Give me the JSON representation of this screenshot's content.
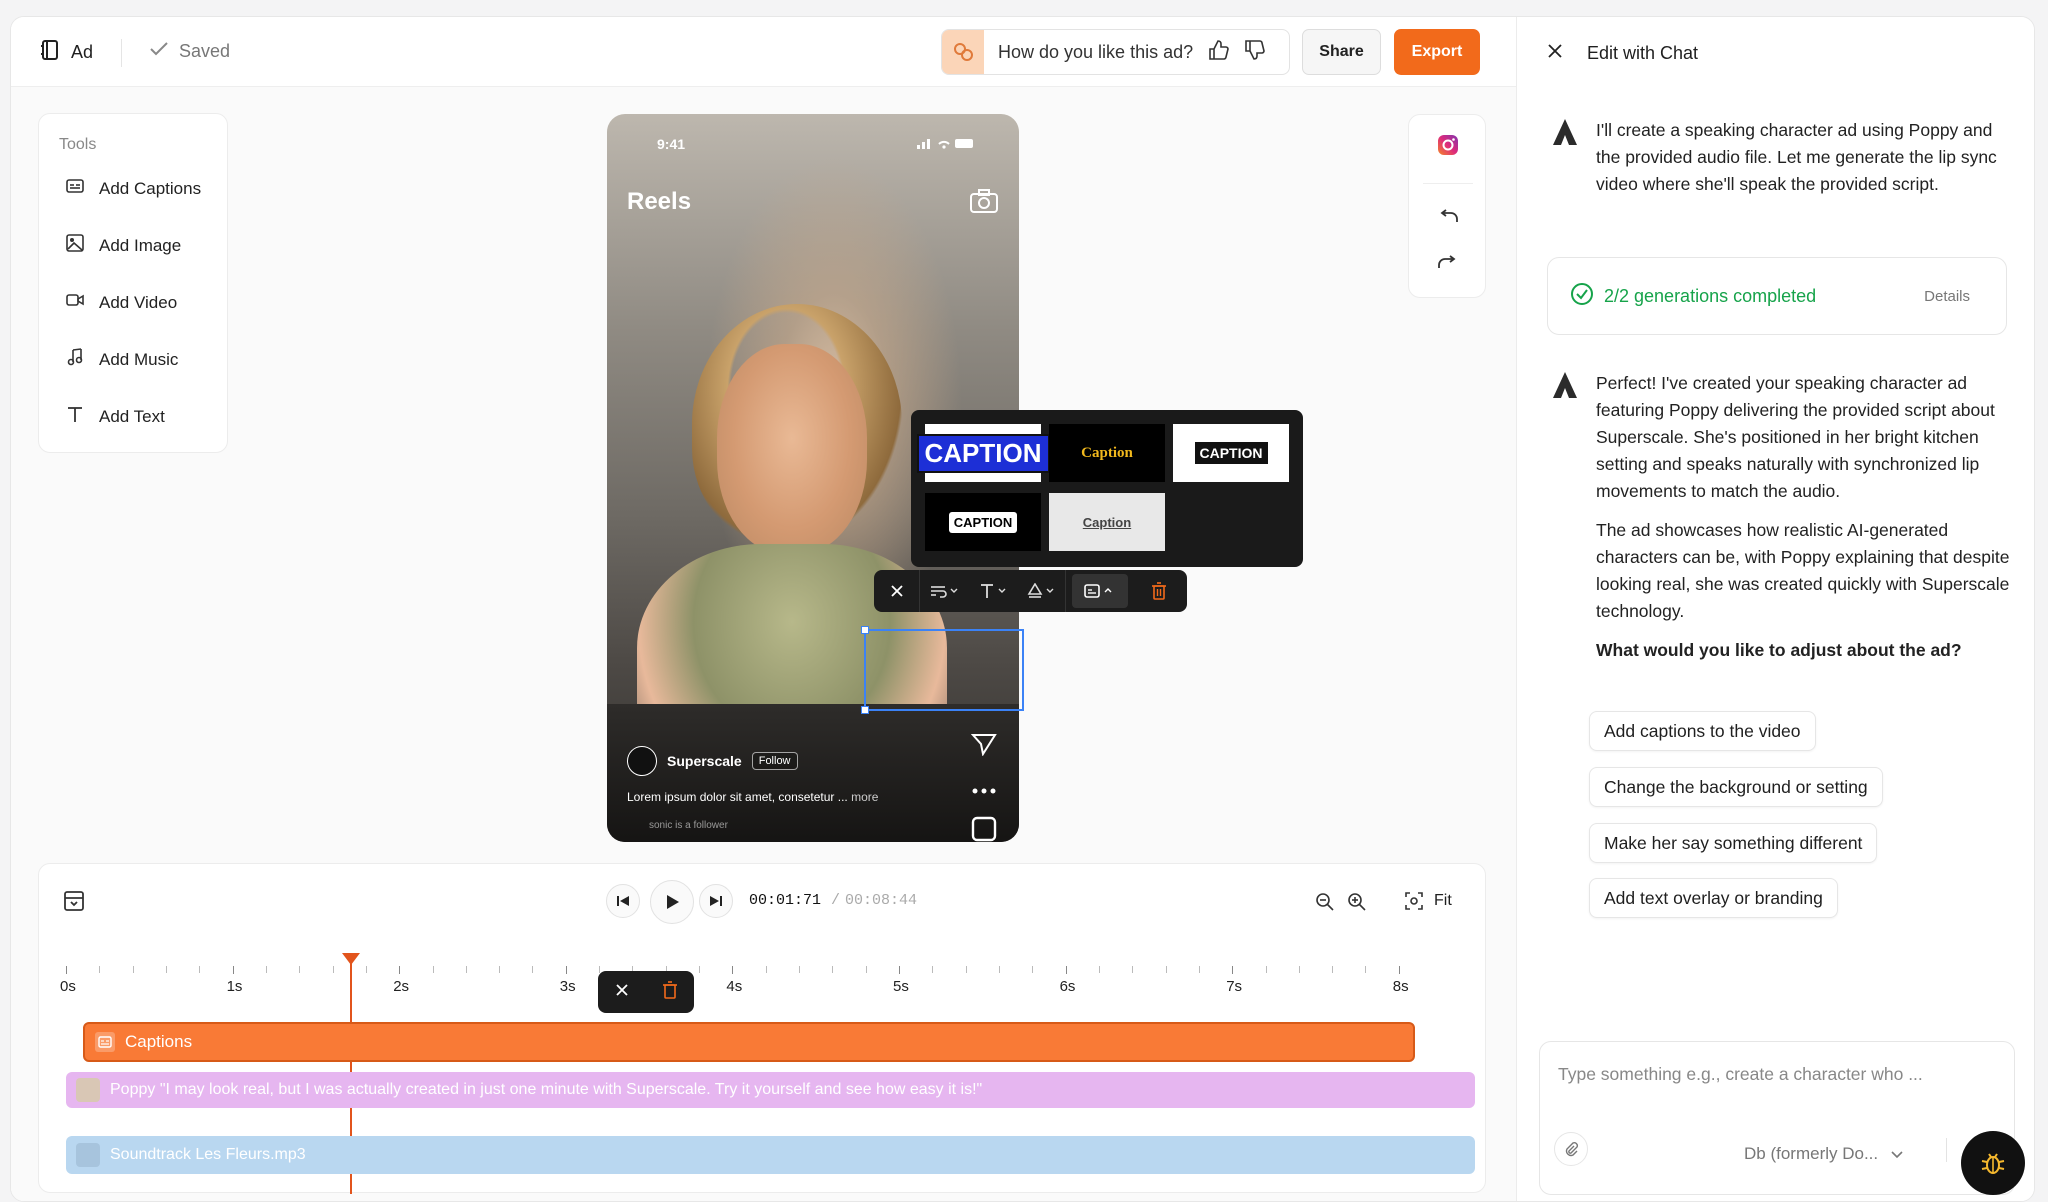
{
  "topbar": {
    "title": "Ad",
    "saved": "Saved",
    "rating_question": "How do you like this ad?",
    "share": "Share",
    "export": "Export"
  },
  "tools": {
    "header": "Tools",
    "items": [
      "Add Captions",
      "Add Image",
      "Add Video",
      "Add Music",
      "Add Text"
    ]
  },
  "phone": {
    "time": "9:41",
    "heading": "Reels",
    "account": "Superscale",
    "follow": "Follow",
    "description": "Lorem ipsum dolor sit amet, consetetur ...",
    "more": "more",
    "follower_note": "sonic is a follower"
  },
  "caption_styles": [
    "CAPTION",
    "Caption",
    "CAPTION",
    "CAPTION",
    "Caption"
  ],
  "timeline": {
    "current": "00:01:71",
    "sep": "/",
    "total": "00:08:44",
    "fit": "Fit",
    "labels": [
      "0s",
      "1s",
      "2s",
      "3s",
      "4s",
      "5s",
      "6s",
      "7s",
      "8s"
    ],
    "playhead_seconds": 1.71,
    "captions_track": "Captions",
    "voice_track": "Poppy \"I may look real, but I was actually created in just one minute with Superscale. Try it yourself and see how easy it is!\"",
    "music_track": "Soundtrack Les Fleurs.mp3"
  },
  "chat": {
    "title": "Edit with Chat",
    "msg1": "I'll create a speaking character ad using Poppy and the provided audio file. Let me generate the lip sync video where she'll speak the provided script.",
    "generations": "2/2 generations completed",
    "details": "Details",
    "msg2a": "Perfect! I've created your speaking character ad featuring Poppy delivering the provided script about Superscale. She's positioned in her bright kitchen setting and speaks naturally with synchronized lip movements to match the audio.",
    "msg2b": "The ad showcases how realistic AI-generated characters can be, with Poppy explaining that despite looking real, she was created quickly with Superscale technology.",
    "question": "What would you like to adjust about the ad?",
    "suggestions": [
      "Add captions to the video",
      "Change the background or setting",
      "Make her say something different",
      "Add text overlay or branding"
    ],
    "input_placeholder": "Type something e.g., create a character who ...",
    "model": "Db (formerly Do..."
  },
  "colors": {
    "accent": "#f26a1b",
    "success": "#16a34a",
    "voice": "#e6b6f0",
    "music": "#b9d7f0"
  }
}
